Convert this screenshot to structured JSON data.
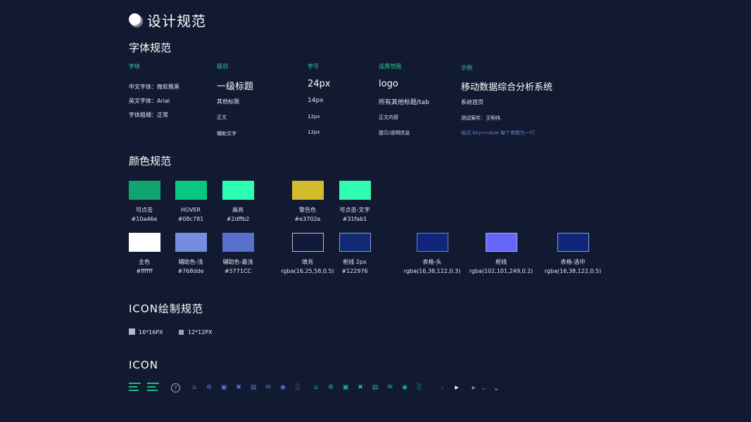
{
  "page": {
    "title": "设计规范"
  },
  "fonts": {
    "section_title": "字体规范",
    "headers": [
      "字体",
      "级别",
      "字号",
      "适用范围",
      "示例"
    ],
    "font_info": [
      "中文字体：微软雅黑",
      "英文字体：Arial",
      "字体粗细：正常"
    ],
    "rows": [
      {
        "level": "一级标题",
        "size": "24px",
        "scope": "logo",
        "example": "移动数据综合分析系统"
      },
      {
        "level": "其他标题",
        "size": "14px",
        "scope": "所有其他标题/tab",
        "example": "系统首页"
      },
      {
        "level": "正文",
        "size": "12px",
        "scope": "正文内容",
        "example": "测试案件：王明伟"
      },
      {
        "level": "辅助文字",
        "size": "12px",
        "scope": "提示/说明信息",
        "example": "格式:key=value 每个参数为一行"
      }
    ]
  },
  "colors": {
    "section_title": "颜色规范",
    "row1": [
      {
        "name": "可点击",
        "code": "#10a46e",
        "color": "#10a46e"
      },
      {
        "name": "HOVER",
        "code": "#08c781",
        "color": "#08c781"
      },
      {
        "name": "高亮",
        "code": "#2dffb2",
        "color": "#2dffb2"
      },
      {
        "name": "警告色",
        "code": "#e3702e",
        "color": "#d4bb2b"
      },
      {
        "name": "可点击-文字",
        "code": "#31fab1",
        "color": "#31fab1"
      }
    ],
    "row2": [
      {
        "name": "主色",
        "code": "#ffffff",
        "color": "#ffffff"
      },
      {
        "name": "辅助色-浅",
        "code": "#768dde",
        "color": "#768dde"
      },
      {
        "name": "辅助色-最浅",
        "code": "#5771CC",
        "color": "#5771CC"
      },
      {
        "name": "填充",
        "code": "rgba(16,25,58,0.5)",
        "color": "#111a3b",
        "border": "#b9c0d8"
      },
      {
        "name": "框线 2px",
        "code": "#122976",
        "color": "#122976",
        "border": "#8a9ae0"
      },
      {
        "name": "表格-头",
        "code": "rgba(16,38,122,0.3)",
        "color": "#10267a",
        "border": "#6c80d6"
      },
      {
        "name": "框线",
        "code": "rgba(102,101,249,0.2)",
        "color": "#6665f9",
        "border": "#a8acff"
      },
      {
        "name": "表格-选中",
        "code": "rgba(16,38,122,0.5)",
        "color": "#10267a",
        "border": "#8a9ae0"
      }
    ]
  },
  "icon_rules": {
    "section_title": "ICON绘制规范",
    "items": [
      {
        "label": "16*16PX"
      },
      {
        "label": "12*12PX"
      }
    ]
  },
  "icons": {
    "section_title": "ICON",
    "help_glyph": "?",
    "blue_set": [
      "home-icon",
      "gear-icon",
      "save-icon",
      "tools-icon",
      "document-icon",
      "mail-icon",
      "globe-icon",
      "bar-chart-icon"
    ],
    "green_set": [
      "home-icon",
      "gear-icon",
      "save-icon",
      "tools-icon",
      "document-icon",
      "mail-icon",
      "globe-icon",
      "bar-chart-icon"
    ],
    "arrows": [
      "chevron-right-icon",
      "triangle-right-icon",
      "triangle-right-small-icon",
      "chevron-down-icon",
      "chevron-down-small-icon"
    ]
  }
}
